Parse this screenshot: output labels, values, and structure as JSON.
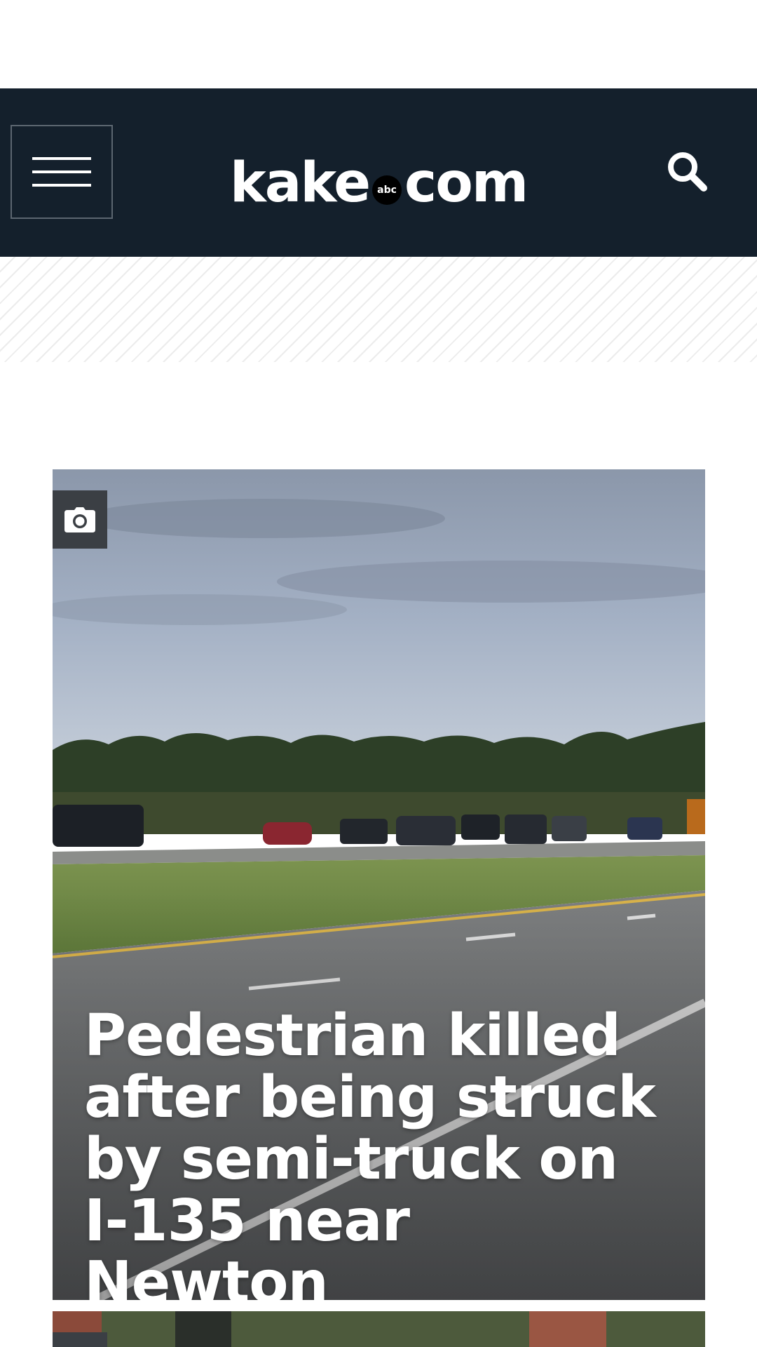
{
  "header": {
    "logo_text_left": "kake",
    "logo_badge": "abc",
    "logo_text_right": "com",
    "menu_icon": "hamburger-menu-icon",
    "search_icon": "search-icon"
  },
  "featured_story": {
    "headline": "Pedestrian killed after being struck by semi-truck on I-135 near Newton",
    "media_icon": "camera-icon"
  },
  "colors": {
    "header_bg": "#14202c",
    "badge_bg": "#3b3f44"
  }
}
